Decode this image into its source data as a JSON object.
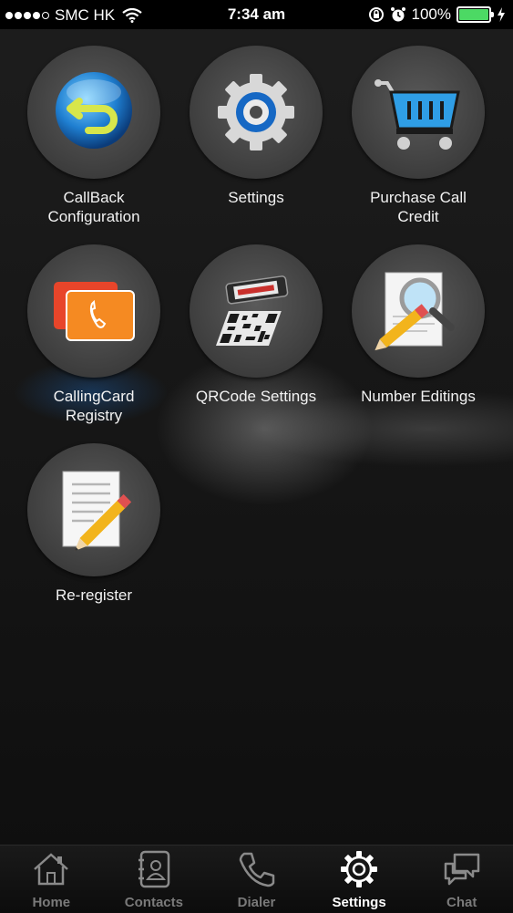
{
  "status_bar": {
    "carrier": "SMC HK",
    "time": "7:34 am",
    "battery": "100%",
    "battery_level": 1.0
  },
  "grid": {
    "items": [
      {
        "label": "CallBack\nConfiguration",
        "icon": "callback-arrow-icon"
      },
      {
        "label": "Settings",
        "icon": "gear-icon"
      },
      {
        "label": "Purchase Call\nCredit",
        "icon": "shopping-cart-icon"
      },
      {
        "label": "CallingCard\nRegistry",
        "icon": "calling-card-icon"
      },
      {
        "label": "QRCode Settings",
        "icon": "qr-code-icon"
      },
      {
        "label": "Number Editings",
        "icon": "document-search-icon"
      },
      {
        "label": "Re-register",
        "icon": "notepad-pencil-icon"
      }
    ]
  },
  "tab_bar": {
    "tabs": [
      {
        "label": "Home",
        "icon": "home-icon"
      },
      {
        "label": "Contacts",
        "icon": "contacts-icon"
      },
      {
        "label": "Dialer",
        "icon": "phone-icon"
      },
      {
        "label": "Settings",
        "icon": "gear-icon"
      },
      {
        "label": "Chat",
        "icon": "chat-bubbles-icon"
      }
    ],
    "active": "Settings"
  },
  "colors": {
    "battery": "#4cd964",
    "tile_bg": "#444444",
    "tab_active": "#ffffff",
    "tab_inactive": "#7a7a7a"
  }
}
